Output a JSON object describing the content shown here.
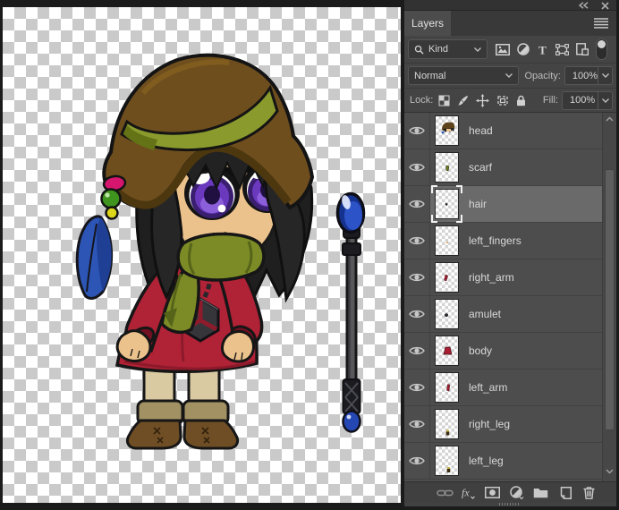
{
  "panel": {
    "tab_label": "Layers",
    "kind_label": "Kind",
    "blend_mode": "Normal",
    "opacity_label": "Opacity:",
    "opacity_value": "100%",
    "lock_label": "Lock:",
    "fill_label": "Fill:",
    "fill_value": "100%",
    "filter_icons": [
      "pixel-layer-filter",
      "adjustment-layer-filter",
      "type-layer-filter",
      "shape-layer-filter",
      "smart-object-filter",
      "filtering-toggle"
    ],
    "lock_icons": [
      "lock-transparent-pixels",
      "lock-image-pixels",
      "lock-position",
      "lock-artboard-nesting",
      "lock-all"
    ],
    "toolbar_icons": [
      "link-layers",
      "layer-style-fx",
      "add-layer-mask",
      "new-adjustment-layer",
      "new-group-folder",
      "new-layer",
      "delete-layer"
    ],
    "layers": [
      {
        "name": "head",
        "visible": true,
        "selected": false
      },
      {
        "name": "scarf",
        "visible": true,
        "selected": false
      },
      {
        "name": "hair",
        "visible": true,
        "selected": true
      },
      {
        "name": "left_fingers",
        "visible": true,
        "selected": false
      },
      {
        "name": "right_arm",
        "visible": true,
        "selected": false
      },
      {
        "name": "amulet",
        "visible": true,
        "selected": false
      },
      {
        "name": "body",
        "visible": true,
        "selected": false
      },
      {
        "name": "left_arm",
        "visible": true,
        "selected": false
      },
      {
        "name": "right_leg",
        "visible": true,
        "selected": false
      },
      {
        "name": "left_leg",
        "visible": true,
        "selected": false
      }
    ]
  },
  "colors": {
    "panel_chrome": "#434343",
    "list_bg": "#4d4d4d",
    "row_selected": "#6a6a6a",
    "field_bg": "#383838",
    "text_light": "#d6d6d6",
    "canvas_checker": "#cacaca",
    "character": {
      "hat": "#6f4e1e",
      "hat_band": "#8a9a2c",
      "hair": "#1f1f1f",
      "skin": "#ecc28c",
      "iris": "#6b39be",
      "scarf": "#7c8b25",
      "dress": "#b02236",
      "legs": "#d9caa2",
      "boot": "#6f4e25",
      "boot_cuff": "#a29263",
      "orb": "#2d53c8",
      "feather": "#2c55b5",
      "bead_pink": "#d6156e",
      "bead_green": "#3f941e",
      "bead_yellow": "#ddd61b"
    }
  }
}
